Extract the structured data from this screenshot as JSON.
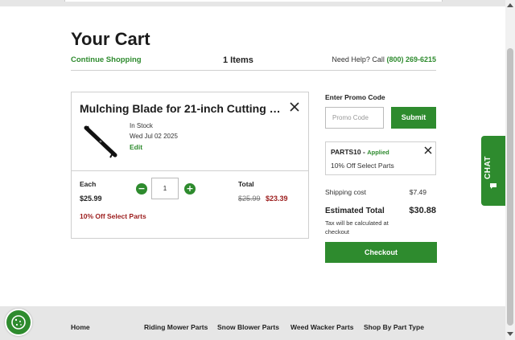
{
  "header": {
    "title": "Your Cart",
    "continue_shopping": "Continue Shopping",
    "items_count": "1 Items",
    "help_text": "Need Help? Call",
    "help_phone": "(800) 269-6215"
  },
  "cart_item": {
    "name": "Mulching Blade for 21-inch Cutting De...",
    "stock_status": "In Stock",
    "date": "Wed Jul 02 2025",
    "edit_label": "Edit",
    "each_label": "Each",
    "each_price": "$25.99",
    "quantity": "1",
    "total_label": "Total",
    "original_total": "$25.99",
    "sale_total": "$23.39",
    "promo_note": "10% Off Select Parts"
  },
  "promo": {
    "label": "Enter Promo Code",
    "placeholder": "Promo Code",
    "submit_label": "Submit",
    "applied_code": "PARTS10",
    "applied_separator": " - ",
    "applied_status": "Applied",
    "applied_description": "10% Off Select Parts"
  },
  "summary": {
    "shipping_label": "Shipping cost",
    "shipping_value": "$7.49",
    "estimated_label": "Estimated Total",
    "estimated_value": "$30.88",
    "tax_note": "Tax will be calculated at checkout",
    "checkout_label": "Checkout"
  },
  "chat": {
    "label": "CHAT"
  },
  "footer": {
    "links": [
      "Home",
      "Riding Mower Parts",
      "Snow Blower Parts",
      "Weed Wacker Parts",
      "Shop By Part Type"
    ]
  },
  "colors": {
    "accent": "#2e8b2e",
    "sale": "#9b1b1b"
  },
  "icons": {
    "close": "close-icon",
    "minus": "minus-icon",
    "plus": "plus-icon",
    "chat": "chat-icon",
    "cookie": "cookie-icon"
  }
}
